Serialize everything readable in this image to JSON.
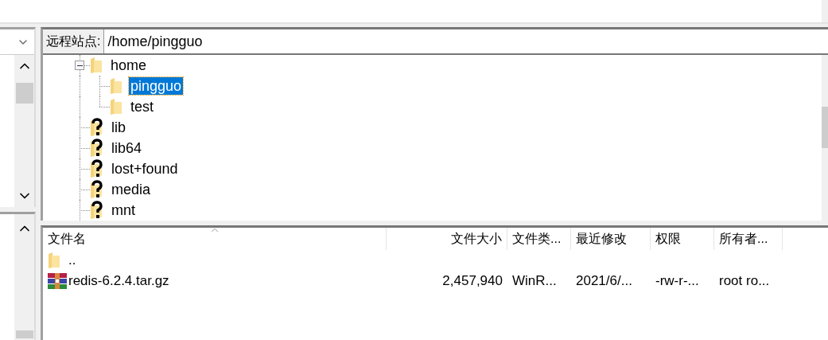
{
  "remote_site": {
    "label": "远程站点:",
    "path": "/home/pingguo"
  },
  "tree": [
    {
      "label": "home",
      "kind": "folder",
      "expanded": true,
      "selected": false,
      "children": [
        {
          "label": "pingguo",
          "kind": "folder",
          "selected": true
        },
        {
          "label": "test",
          "kind": "folder",
          "selected": false
        }
      ]
    },
    {
      "label": "lib",
      "kind": "unknown",
      "selected": false
    },
    {
      "label": "lib64",
      "kind": "unknown",
      "selected": false
    },
    {
      "label": "lost+found",
      "kind": "unknown",
      "selected": false
    },
    {
      "label": "media",
      "kind": "unknown",
      "selected": false
    },
    {
      "label": "mnt",
      "kind": "unknown",
      "selected": false
    }
  ],
  "file_list": {
    "columns": [
      {
        "label": "文件名",
        "kind": "text",
        "sorted": true
      },
      {
        "label": "文件大小",
        "kind": "number",
        "sorted": false
      },
      {
        "label": "文件类...",
        "kind": "text",
        "sorted": false
      },
      {
        "label": "最近修改",
        "kind": "text",
        "sorted": false
      },
      {
        "label": "权限",
        "kind": "text",
        "sorted": false
      },
      {
        "label": "所有者...",
        "kind": "text",
        "sorted": false
      }
    ],
    "rows": [
      {
        "kind": "folder",
        "cells": [
          ".."
        ]
      },
      {
        "kind": "archive",
        "cells": [
          "redis-6.2.4.tar.gz",
          "2,457,940",
          "WinR...",
          "2021/6/...",
          "-rw-r-...",
          "root ro..."
        ]
      }
    ]
  }
}
